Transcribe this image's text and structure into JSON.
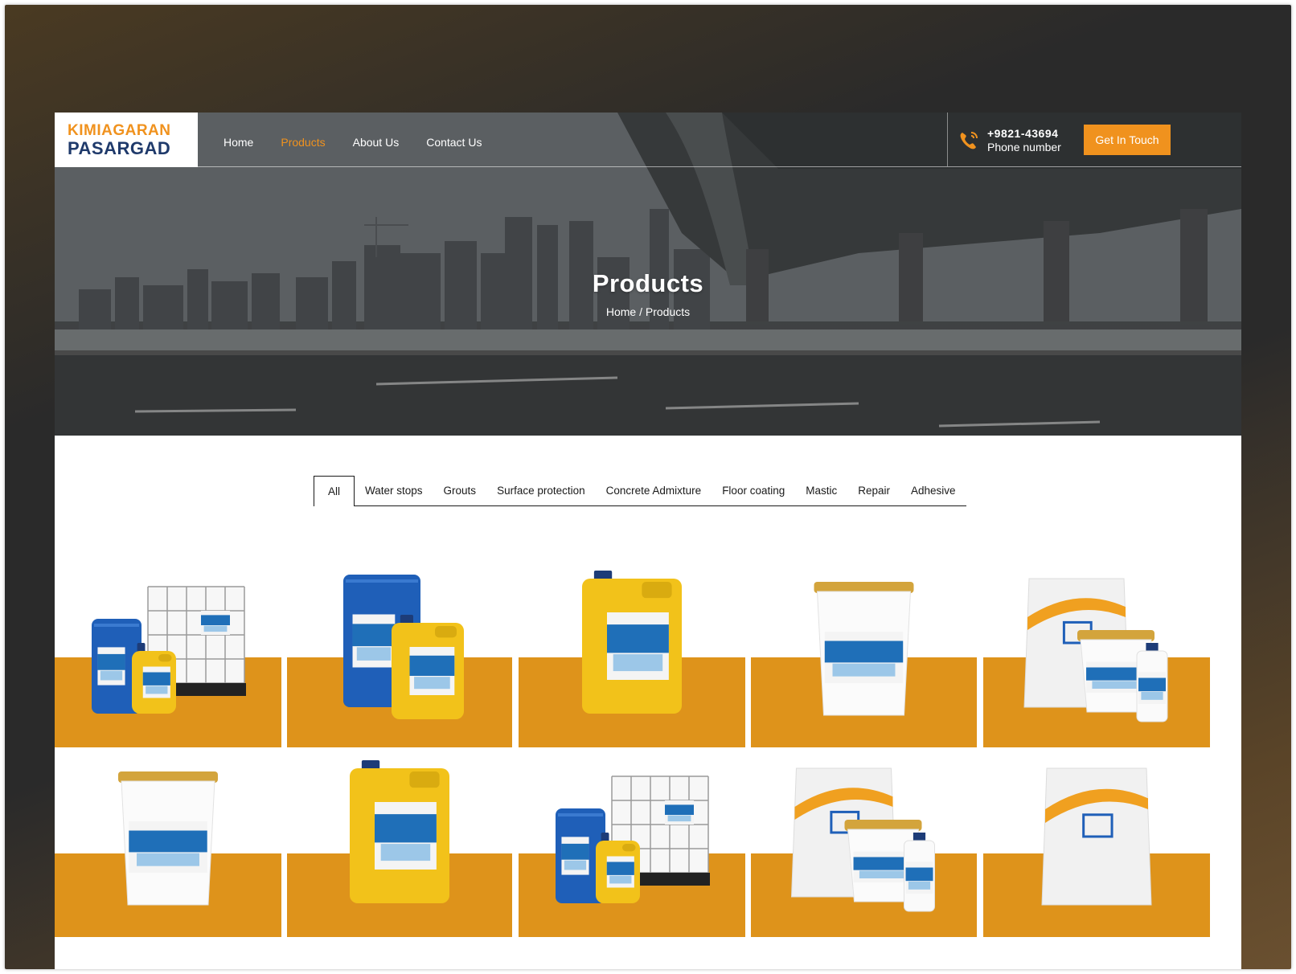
{
  "header": {
    "logo": {
      "line1": "KIMIAGARAN",
      "line2": "PASARGAD"
    },
    "nav": [
      {
        "label": "Home",
        "active": false
      },
      {
        "label": "Products",
        "active": true
      },
      {
        "label": "About Us",
        "active": false
      },
      {
        "label": "Contact Us",
        "active": false
      }
    ],
    "phone": {
      "number": "+9821-43694",
      "label": "Phone number",
      "icon": "phone-icon"
    },
    "cta_label": "Get In Touch"
  },
  "hero": {
    "title": "Products",
    "breadcrumb": "Home / Products"
  },
  "filters": {
    "tabs": [
      "All",
      "Water stops",
      "Grouts",
      "Surface protection",
      "Concrete Admixture",
      "Floor coating",
      "Mastic",
      "Repair",
      "Adhesive"
    ],
    "active": "All"
  },
  "products": [
    {
      "kind": "ibc-drum-jerrycan"
    },
    {
      "kind": "drum-jerrycan"
    },
    {
      "kind": "jerrycan"
    },
    {
      "kind": "bucket"
    },
    {
      "kind": "bag-bucket-bottle"
    },
    {
      "kind": "bucket"
    },
    {
      "kind": "jerrycan"
    },
    {
      "kind": "ibc-drum-jerrycan"
    },
    {
      "kind": "bag-bucket-bottle"
    },
    {
      "kind": "bag"
    }
  ],
  "colors": {
    "accent": "#f0921e",
    "band": "#de931b",
    "brand_blue": "#1f3a6b"
  }
}
